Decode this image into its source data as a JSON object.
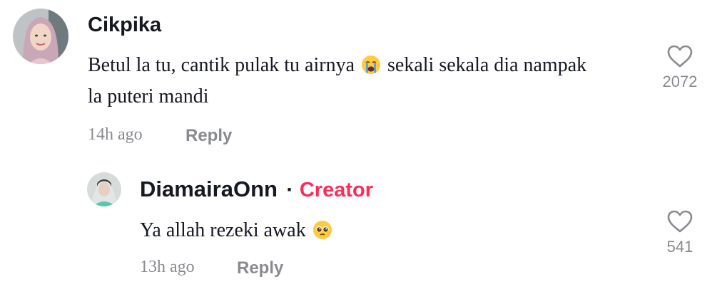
{
  "comment": {
    "username": "Cikpika",
    "text_part1": "Betul la tu, cantik pulak tu airnya",
    "emoji": "crying-face-emoji",
    "text_part2": "sekali sekala dia nampak la puteri mandi",
    "time": "14h ago",
    "reply_label": "Reply",
    "like_count": "2072",
    "like_icon": "heart-outline-icon"
  },
  "reply": {
    "username": "DiamairaOnn",
    "separator": "·",
    "badge": "Creator",
    "text": "Ya allah rezeki awak",
    "emoji": "pleading-face-emoji",
    "time": "13h ago",
    "reply_label": "Reply",
    "like_count": "541",
    "like_icon": "heart-outline-icon"
  },
  "colors": {
    "text": "#161823",
    "muted": "#8a8b91",
    "creator": "#fe2c55",
    "background": "#ffffff"
  }
}
